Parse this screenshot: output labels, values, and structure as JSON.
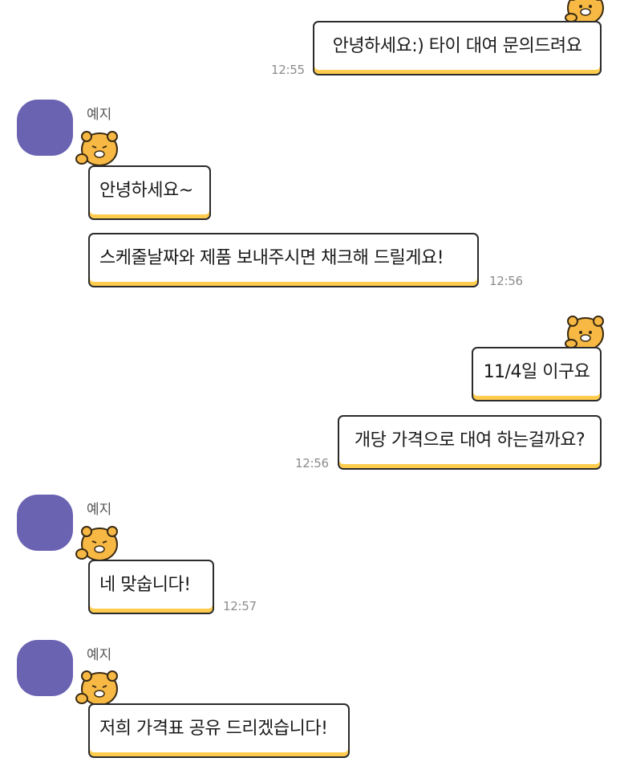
{
  "sender_name": "예지",
  "colors": {
    "avatar": "#6a63b2",
    "bubble_accent": "#ffcc4d",
    "sticker_face": "#f7b944"
  },
  "messages": [
    {
      "side": "right",
      "text": "안녕하세요:) 타이 대여 문의드려요",
      "time": "12:55"
    },
    {
      "side": "left",
      "text": "안녕하세요~"
    },
    {
      "side": "left",
      "text": "스케줄날짜와 제품 보내주시면 채크해 드릴게요!",
      "time": "12:56"
    },
    {
      "side": "right",
      "text": "11/4일 이구요"
    },
    {
      "side": "right",
      "text": "개당 가격으로 대여 하는걸까요?",
      "time": "12:56"
    },
    {
      "side": "left",
      "text": "네 맞숩니다!",
      "time": "12:57"
    },
    {
      "side": "left",
      "text": "저희 가격표 공유 드리겠습니다!"
    }
  ],
  "icons": {
    "sticker": "ryan-character-icon",
    "avatar": "profile-avatar"
  }
}
